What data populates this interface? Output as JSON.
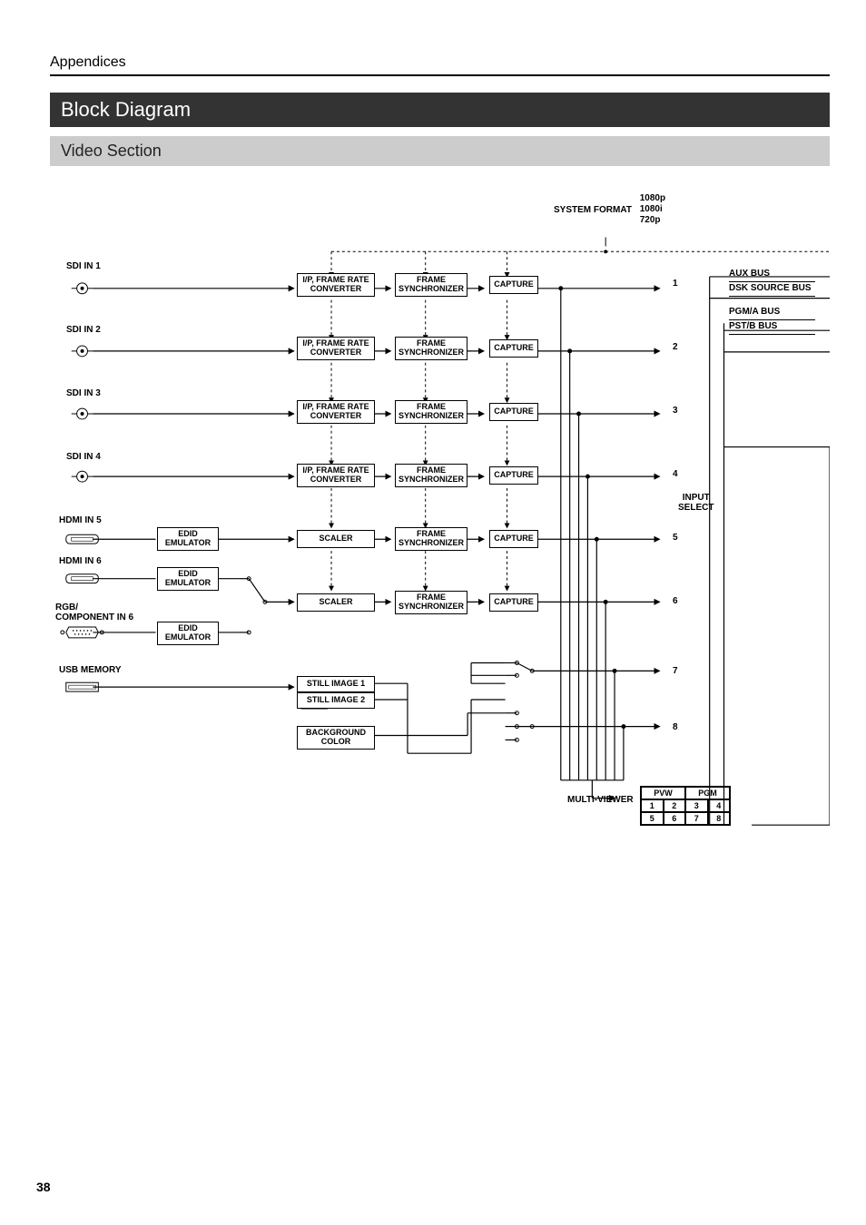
{
  "page": {
    "breadcrumb": "Appendices",
    "page_number": "38",
    "title": "Block Diagram",
    "section": "Video Section"
  },
  "system_format": {
    "label": "SYSTEM FORMAT",
    "values": [
      "1080p",
      "1080i",
      "720p"
    ]
  },
  "inputs": [
    {
      "label": "SDI IN 1",
      "proc1": "I/P, FRAME RATE",
      "proc1b": "CONVERTER",
      "proc2": "FRAME",
      "proc2b": "SYNCHRONIZER",
      "proc3": "CAPTURE",
      "num": "1"
    },
    {
      "label": "SDI IN 2",
      "proc1": "I/P, FRAME RATE",
      "proc1b": "CONVERTER",
      "proc2": "FRAME",
      "proc2b": "SYNCHRONIZER",
      "proc3": "CAPTURE",
      "num": "2"
    },
    {
      "label": "SDI IN 3",
      "proc1": "I/P, FRAME RATE",
      "proc1b": "CONVERTER",
      "proc2": "FRAME",
      "proc2b": "SYNCHRONIZER",
      "proc3": "CAPTURE",
      "num": "3"
    },
    {
      "label": "SDI IN 4",
      "proc1": "I/P, FRAME RATE",
      "proc1b": "CONVERTER",
      "proc2": "FRAME",
      "proc2b": "SYNCHRONIZER",
      "proc3": "CAPTURE",
      "num": "4"
    }
  ],
  "hdmi5": {
    "label": "HDMI IN 5",
    "edid": "EDID",
    "edidb": "EMULATOR",
    "proc1": "SCALER",
    "proc2": "FRAME",
    "proc2b": "SYNCHRONIZER",
    "proc3": "CAPTURE",
    "num": "5"
  },
  "hdmi6": {
    "label": "HDMI IN 6",
    "edid": "EDID",
    "edidb": "EMULATOR",
    "proc1": "SCALER",
    "proc2": "FRAME",
    "proc2b": "SYNCHRONIZER",
    "proc3": "CAPTURE",
    "num": "6"
  },
  "rgb": {
    "label": "RGB/",
    "label2": "COMPONENT IN 6",
    "edid": "EDID",
    "edidb": "EMULATOR"
  },
  "usb": {
    "label": "USB MEMORY",
    "still1": "STILL IMAGE 1",
    "still2": "STILL IMAGE 2",
    "num7": "7"
  },
  "bg": {
    "label": "BACKGROUND",
    "label2": "COLOR",
    "num8": "8"
  },
  "input_select": {
    "l1": "INPUT",
    "l2": "SELECT"
  },
  "buses": {
    "aux": "AUX BUS",
    "dsk": "DSK SOURCE BUS",
    "pgma": "PGM/A BUS",
    "pstb": "PST/B BUS"
  },
  "multiviewer": {
    "label": "MULTI-VIEWER",
    "pvw": "PVW",
    "pgm": "PGM",
    "cells": [
      "1",
      "2",
      "3",
      "4",
      "5",
      "6",
      "7",
      "8"
    ]
  }
}
